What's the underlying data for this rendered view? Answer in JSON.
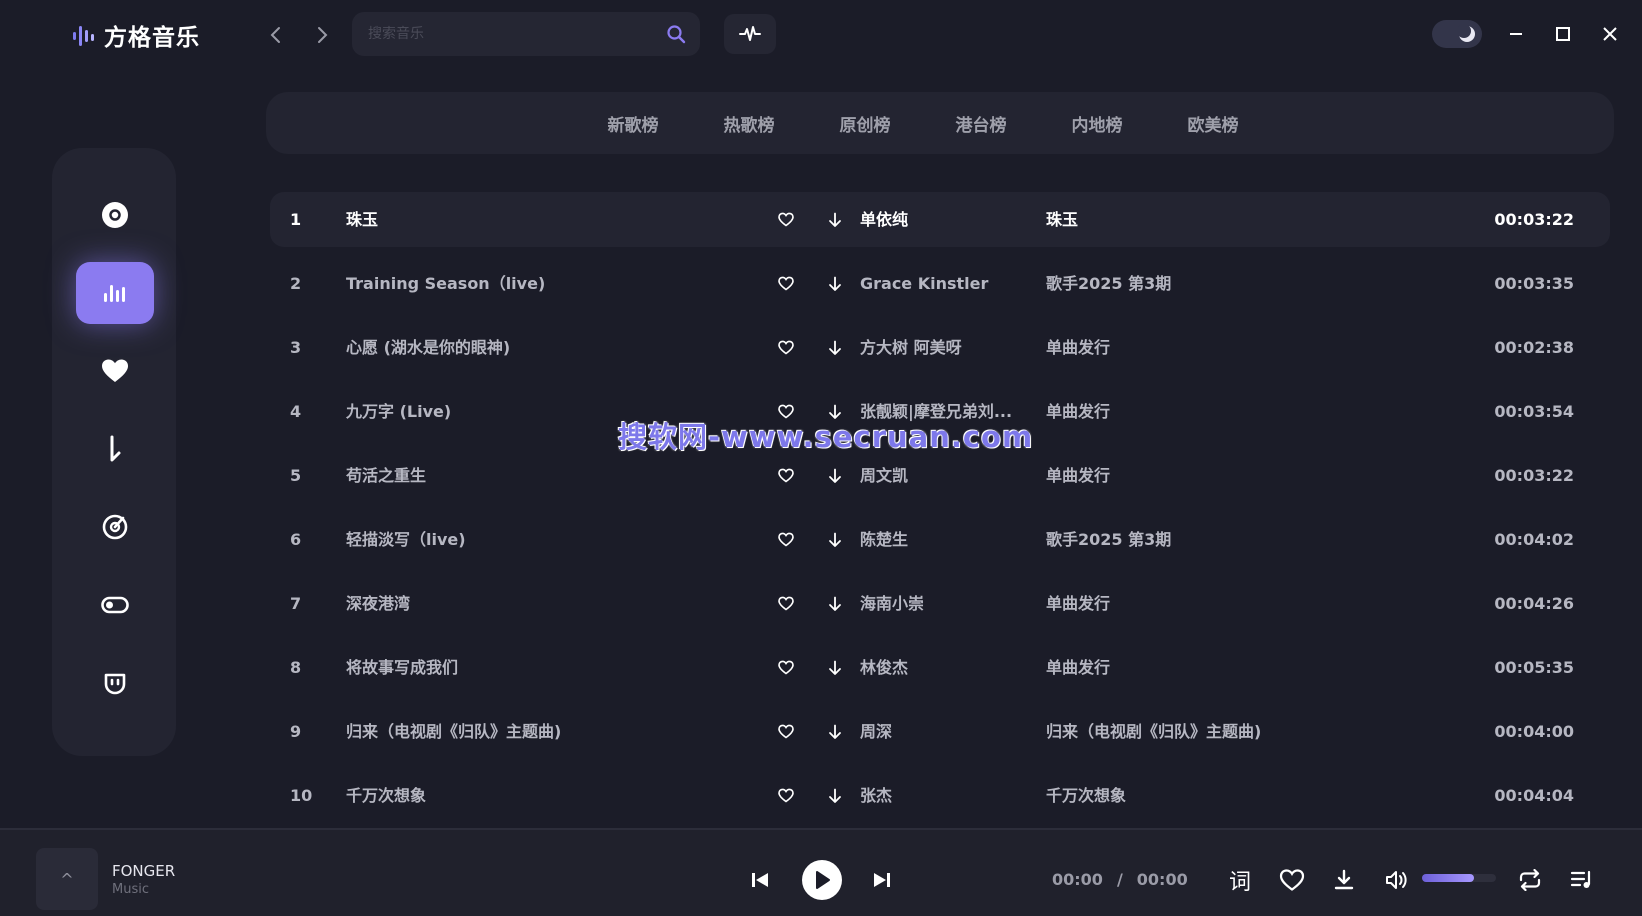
{
  "app": {
    "title": "方格音乐"
  },
  "search": {
    "placeholder": "搜索音乐"
  },
  "tabs": [
    {
      "label": "新歌榜"
    },
    {
      "label": "热歌榜"
    },
    {
      "label": "原创榜"
    },
    {
      "label": "港台榜"
    },
    {
      "label": "内地榜"
    },
    {
      "label": "欧美榜"
    }
  ],
  "sidebar": {
    "items": [
      {
        "icon": "disc-icon"
      },
      {
        "icon": "chart-icon",
        "active": true
      },
      {
        "icon": "heart-icon"
      },
      {
        "icon": "download-icon"
      },
      {
        "icon": "radar-icon"
      },
      {
        "icon": "toggle-icon"
      },
      {
        "icon": "bot-icon"
      }
    ]
  },
  "songs": [
    {
      "rank": "1",
      "title": "珠玉",
      "artist": "单依纯",
      "album": "珠玉",
      "duration": "00:03:22",
      "active": true
    },
    {
      "rank": "2",
      "title": "Training Season（live)",
      "artist": "Grace Kinstler",
      "album": "歌手2025 第3期",
      "duration": "00:03:35"
    },
    {
      "rank": "3",
      "title": "心愿 (湖水是你的眼神)",
      "artist": "方大树 阿美呀",
      "album": "单曲发行",
      "duration": "00:02:38"
    },
    {
      "rank": "4",
      "title": "九万字 (Live)",
      "artist": "张靓颖|摩登兄弟刘...",
      "album": "单曲发行",
      "duration": "00:03:54"
    },
    {
      "rank": "5",
      "title": "苟活之重生",
      "artist": "周文凯",
      "album": "单曲发行",
      "duration": "00:03:22"
    },
    {
      "rank": "6",
      "title": "轻描淡写（live)",
      "artist": "陈楚生",
      "album": "歌手2025 第3期",
      "duration": "00:04:02"
    },
    {
      "rank": "7",
      "title": "深夜港湾",
      "artist": "海南小崇",
      "album": "单曲发行",
      "duration": "00:04:26"
    },
    {
      "rank": "8",
      "title": "将故事写成我们",
      "artist": "林俊杰",
      "album": "单曲发行",
      "duration": "00:05:35"
    },
    {
      "rank": "9",
      "title": "归来（电视剧《归队》主题曲)",
      "artist": "周深",
      "album": "归来（电视剧《归队》主题曲)",
      "duration": "00:04:00"
    },
    {
      "rank": "10",
      "title": "千万次想象",
      "artist": "张杰",
      "album": "千万次想象",
      "duration": "00:04:04"
    }
  ],
  "watermark": "搜软网-www.secruan.com",
  "player": {
    "cover_glyph": "^",
    "song": "FONGER",
    "artist": "Music",
    "current": "00:00",
    "separator": "/",
    "total": "00:00",
    "lyrics_label": "词",
    "volume": 0.7
  },
  "colors": {
    "accent": "#8b7bf0",
    "background": "#1b1c28",
    "panel": "#232431"
  }
}
